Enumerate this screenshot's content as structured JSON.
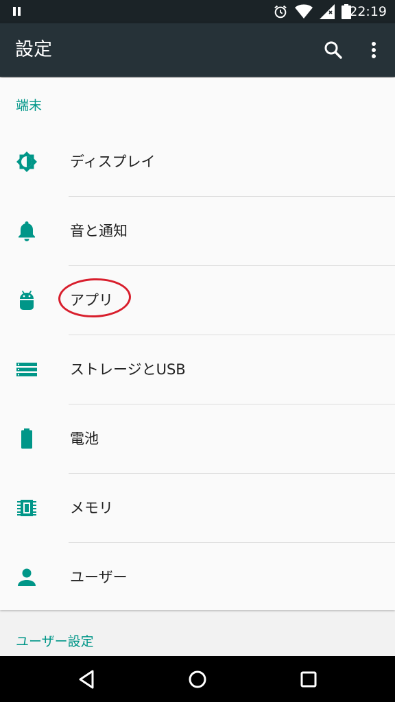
{
  "status_bar": {
    "time": "22:19",
    "icons": [
      "pause-icon",
      "alarm-icon",
      "wifi-icon",
      "cell-signal-icon",
      "battery-icon"
    ]
  },
  "app_bar": {
    "title": "設定",
    "actions": [
      "search-icon",
      "more-vert-icon"
    ]
  },
  "sections": [
    {
      "header": "端末",
      "items": [
        {
          "label": "ディスプレイ",
          "icon": "brightness-icon"
        },
        {
          "label": "音と通知",
          "icon": "bell-icon"
        },
        {
          "label": "アプリ",
          "icon": "android-icon"
        },
        {
          "label": "ストレージとUSB",
          "icon": "storage-icon"
        },
        {
          "label": "電池",
          "icon": "battery-icon"
        },
        {
          "label": "メモリ",
          "icon": "memory-chip-icon"
        },
        {
          "label": "ユーザー",
          "icon": "person-icon"
        }
      ]
    },
    {
      "header": "ユーザー設定",
      "items": []
    }
  ],
  "nav_bar": {
    "buttons": [
      "back-icon",
      "home-icon",
      "recents-icon"
    ]
  },
  "colors": {
    "accent": "#009688",
    "app_bar": "#263238",
    "status_bar": "#1b2327",
    "annotation": "#d81e2c"
  }
}
